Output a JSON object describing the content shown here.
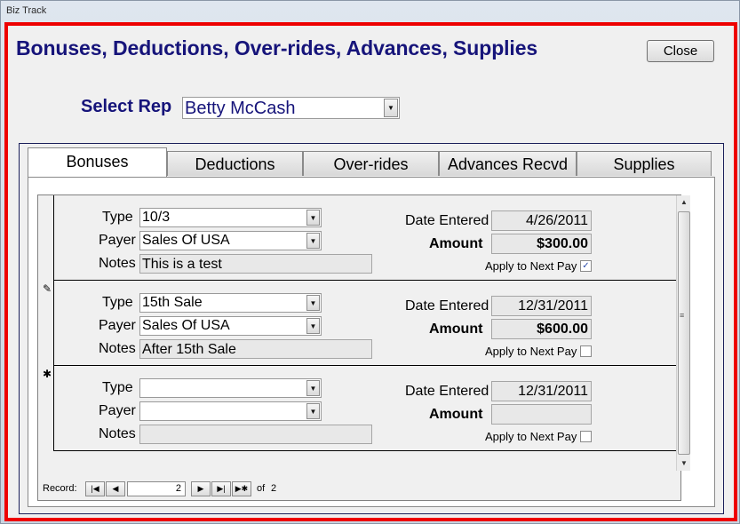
{
  "window": {
    "title": "Biz Track"
  },
  "form": {
    "title": "Bonuses, Deductions, Over-rides, Advances, Supplies",
    "close_label": "Close",
    "rep_label": "Select Rep",
    "rep_value": "Betty McCash"
  },
  "tabs": [
    {
      "label": "Bonuses",
      "active": true
    },
    {
      "label": "Deductions",
      "active": false
    },
    {
      "label": "Over-rides",
      "active": false
    },
    {
      "label": "Advances Recvd",
      "active": false
    },
    {
      "label": "Supplies",
      "active": false
    }
  ],
  "field_labels": {
    "type": "Type",
    "payer": "Payer",
    "notes": "Notes",
    "date_entered": "Date Entered",
    "amount": "Amount",
    "apply_next_pay": "Apply to Next Pay"
  },
  "records": [
    {
      "selector": "",
      "type": "10/3",
      "payer": "Sales Of USA",
      "notes": "This is a test",
      "date_entered": "4/26/2011",
      "amount": "$300.00",
      "apply_next_pay": true
    },
    {
      "selector": "✎",
      "type": "15th Sale",
      "payer": "Sales Of USA",
      "notes": "After 15th Sale",
      "date_entered": "12/31/2011",
      "amount": "$600.00",
      "apply_next_pay": false
    },
    {
      "selector": "✱",
      "type": "",
      "payer": "",
      "notes": "",
      "date_entered": "12/31/2011",
      "amount": "",
      "apply_next_pay": false
    }
  ],
  "navigation": {
    "record_label": "Record:",
    "current": "2",
    "of_label": "of",
    "total": "2"
  }
}
